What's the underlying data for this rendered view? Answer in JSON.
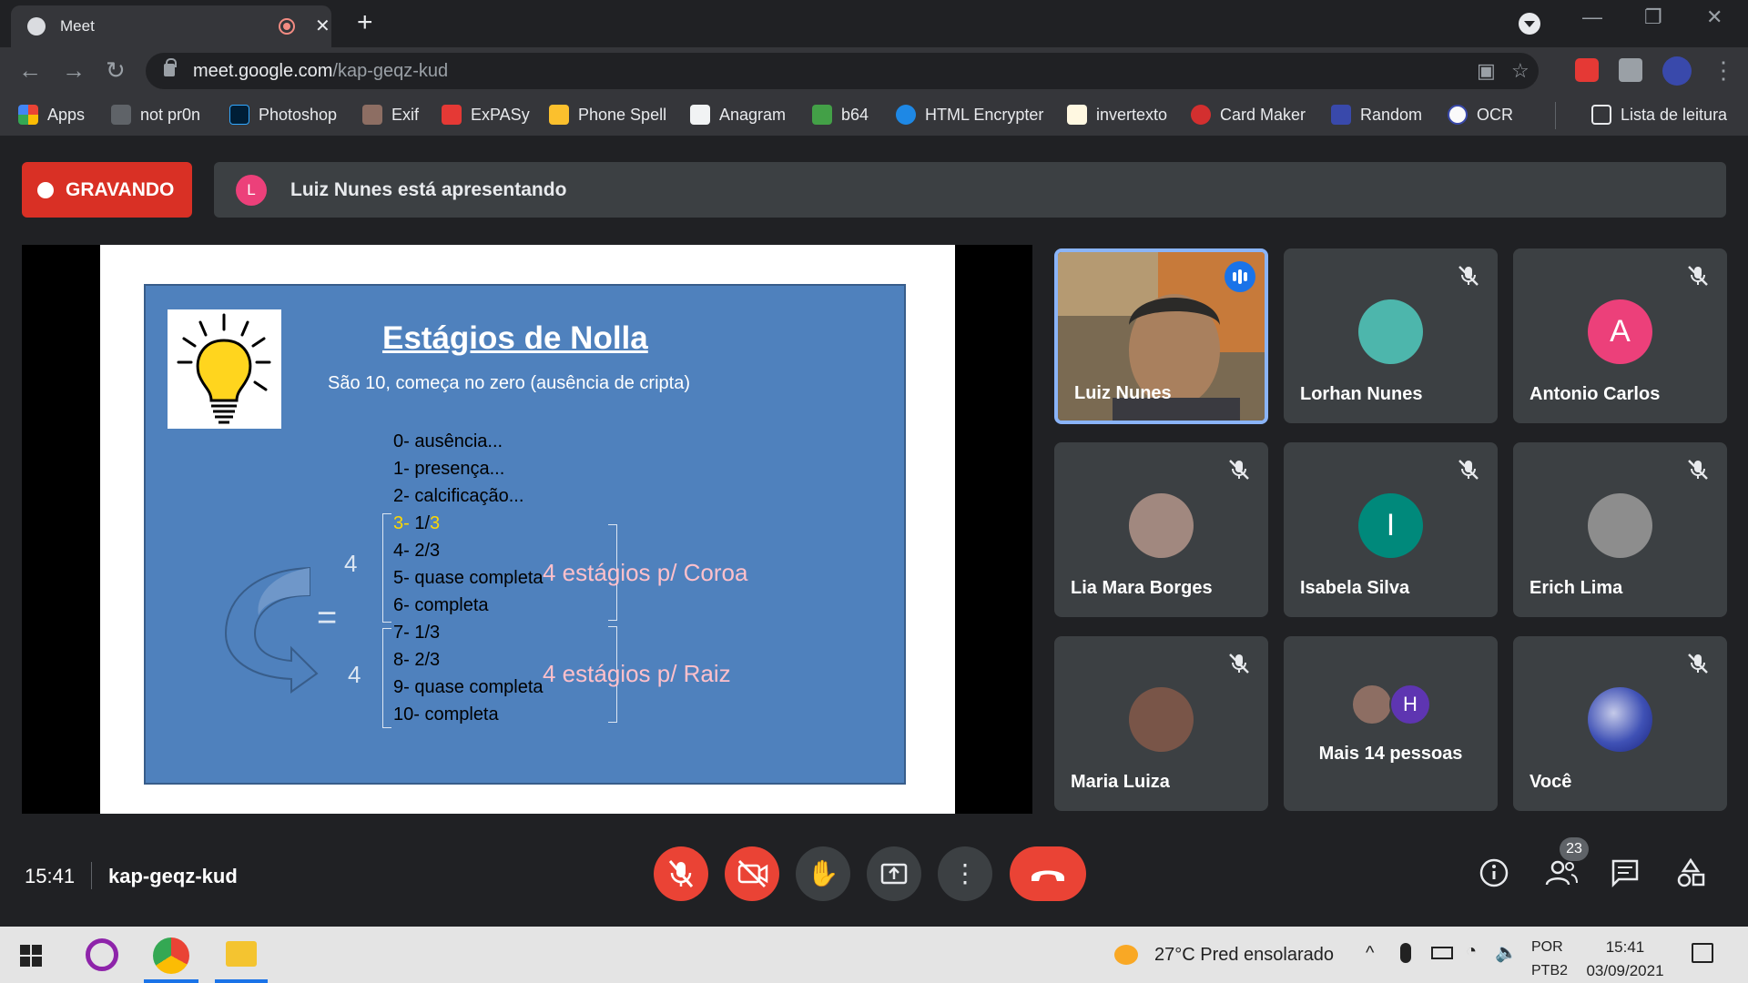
{
  "browser": {
    "tab_title": "Meet",
    "url_host": "meet.google.com",
    "url_path": "/kap-geqz-kud",
    "bookmarks": [
      {
        "label": "Apps",
        "color": "#4285f4"
      },
      {
        "label": "not pr0n",
        "color": "#e8eaed"
      },
      {
        "label": "Photoshop",
        "color": "#31a8ff"
      },
      {
        "label": "Exif",
        "color": "#8d6e63"
      },
      {
        "label": "ExPASy",
        "color": "#e53935"
      },
      {
        "label": "Phone Spell",
        "color": "#fbc02d"
      },
      {
        "label": "Anagram",
        "color": "#f1f3f4"
      },
      {
        "label": "b64",
        "color": "#43a047"
      },
      {
        "label": "HTML Encrypter",
        "color": "#1e88e5"
      },
      {
        "label": "invertexto",
        "color": "#fff8e1"
      },
      {
        "label": "Card Maker",
        "color": "#d32f2f"
      },
      {
        "label": "Random",
        "color": "#3949ab"
      },
      {
        "label": "OCR",
        "color": "#fafafa"
      }
    ],
    "reading_list": "Lista de leitura"
  },
  "meet": {
    "recording_label": "GRAVANDO",
    "presenter_initial": "L",
    "presenting_text": "Luiz Nunes está apresentando",
    "time": "15:41",
    "meeting_code": "kap-geqz-kud",
    "participant_count": "23",
    "slide": {
      "title": "Estágios de Nolla",
      "subtitle": "São 10, começa no zero (ausência de cripta)",
      "items": [
        "0- ausência...",
        "1- presença...",
        "2- calcificação...",
        "4- 2/3",
        "5- quase completa",
        "6- completa",
        "7- 1/3",
        "8- 2/3",
        "9- quase completa",
        "10- completa"
      ],
      "item3_num": "3-",
      "item3_frac": " 1/",
      "item3_den": "3",
      "four_a": "4",
      "four_b": "4",
      "equals": "=",
      "crown": "4 estágios p/ Coroa",
      "root": "4 estágios p/ Raiz"
    },
    "participants": [
      {
        "name": "Luiz Nunes",
        "type": "video"
      },
      {
        "name": "Lorhan Nunes",
        "type": "photo",
        "color": "#4db6ac"
      },
      {
        "name": "Antonio Carlos",
        "type": "initial",
        "initial": "A",
        "color": "#ec407a"
      },
      {
        "name": "Lia Mara Borges",
        "type": "photo",
        "color": "#a1887f"
      },
      {
        "name": "Isabela Silva",
        "type": "initial",
        "initial": "I",
        "color": "#00897b"
      },
      {
        "name": "Erich Lima",
        "type": "photo",
        "color": "#8d8d8d"
      },
      {
        "name": "Maria Luiza",
        "type": "photo",
        "color": "#795548"
      },
      {
        "name": "Mais 14 pessoas",
        "type": "group",
        "initial": "H",
        "color": "#5e35b1"
      },
      {
        "name": "Você",
        "type": "photo",
        "color": "#3f51b5"
      }
    ]
  },
  "taskbar": {
    "weather": "27°C  Pred ensolarado",
    "lang1": "POR",
    "lang2": "PTB2",
    "time": "15:41",
    "date": "03/09/2021"
  }
}
